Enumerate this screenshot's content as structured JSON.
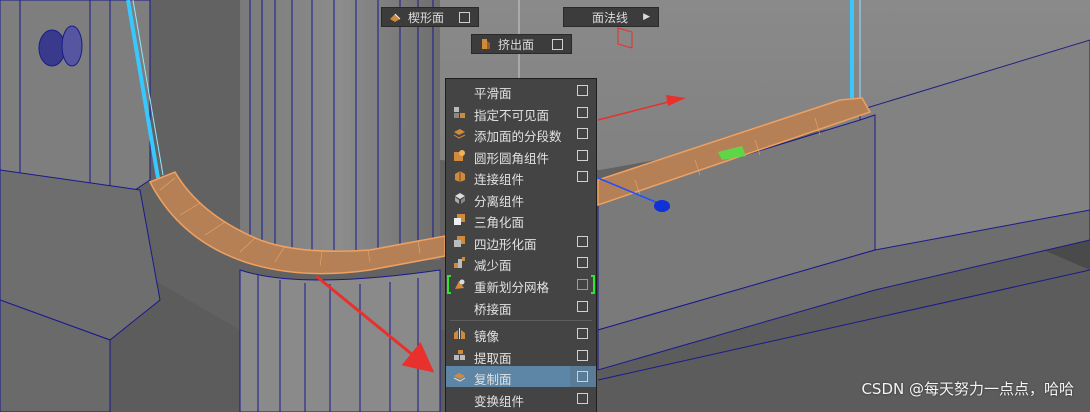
{
  "hud": {
    "wedge_face": "楔形面",
    "face_normals": "面法线",
    "extrude_face": "挤出面"
  },
  "menu": {
    "items": [
      {
        "label": "平滑面",
        "has_option": true,
        "icon": "none"
      },
      {
        "label": "指定不可见面",
        "has_option": true,
        "icon": "assign-invisible-icon"
      },
      {
        "label": "添加面的分段数",
        "has_option": true,
        "icon": "add-divisions-icon"
      },
      {
        "label": "圆形圆角组件",
        "has_option": true,
        "icon": "circularize-icon"
      },
      {
        "label": "连接组件",
        "has_option": true,
        "icon": "connect-icon"
      },
      {
        "label": "分离组件",
        "has_option": false,
        "icon": "detach-icon"
      },
      {
        "label": "三角化面",
        "has_option": false,
        "icon": "triangulate-icon"
      },
      {
        "label": "四边形化面",
        "has_option": true,
        "icon": "quadrangulate-icon"
      },
      {
        "label": "减少面",
        "has_option": true,
        "icon": "reduce-icon"
      },
      {
        "label": "重新划分网格",
        "has_option": true,
        "icon": "remesh-icon"
      },
      {
        "label": "桥接面",
        "has_option": true,
        "icon": "none"
      },
      {
        "label": "镜像",
        "has_option": true,
        "icon": "mirror-icon"
      },
      {
        "label": "提取面",
        "has_option": true,
        "icon": "extract-icon"
      },
      {
        "label": "复制面",
        "has_option": true,
        "icon": "duplicate-icon"
      },
      {
        "label": "变换组件",
        "has_option": true,
        "icon": "none"
      }
    ]
  },
  "watermark": "CSDN @每天努力一点点，哈哈",
  "colors": {
    "menu_bg": "#444444",
    "highlight": "#5c85a6",
    "selection_edges": "#f0a060",
    "wireframe": "#1a1a8c",
    "annotation_arrow": "#e8302c"
  }
}
